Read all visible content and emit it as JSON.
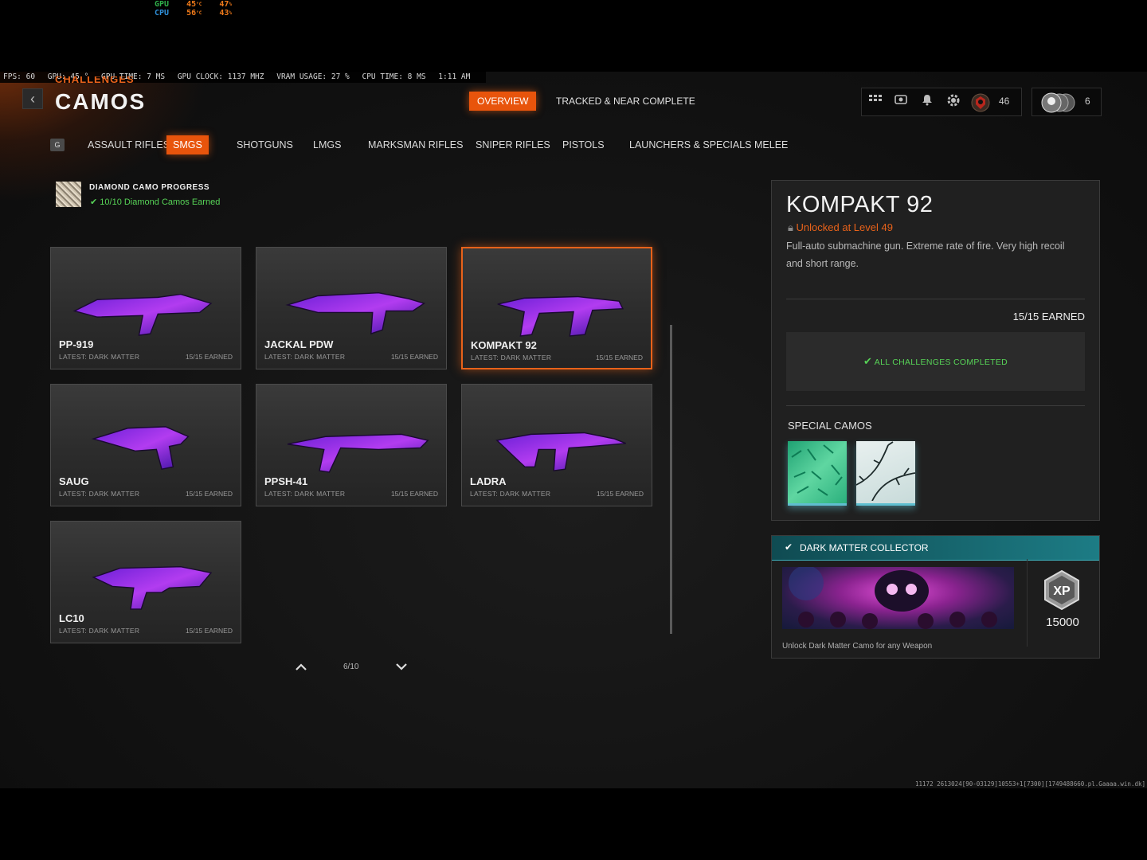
{
  "monitor": {
    "gpu_label": "GPU",
    "cpu_label": "CPU",
    "gpu_temp": "45",
    "gpu_load": "47",
    "cpu_temp": "56",
    "cpu_load": "43",
    "temp_unit": "°C",
    "load_unit": "%"
  },
  "stats_bar": {
    "fps": "FPS:  60",
    "gpu": "GPU: 45 °",
    "gpu_time": "GPU TIME:  7 MS",
    "gpu_clock": "GPU CLOCK: 1137 MHZ",
    "vram": "VRAM USAGE: 27 %",
    "cpu_time": "CPU TIME:  8 MS",
    "clock": "1:11 AM"
  },
  "header": {
    "breadcrumb": "CHALLENGES",
    "title": "CAMOS",
    "tabs": [
      "OVERVIEW",
      "TRACKED & NEAR COMPLETE"
    ],
    "level": "46",
    "prestige": "6"
  },
  "categories": {
    "key_hint": "G",
    "items": [
      "ASSAULT RIFLES",
      "SMGS",
      "SHOTGUNS",
      "LMGS",
      "MARKSMAN RIFLES",
      "SNIPER RIFLES",
      "PISTOLS",
      "LAUNCHERS & SPECIALS",
      "MELEE"
    ],
    "active": "SMGS"
  },
  "diamond": {
    "title": "DIAMOND CAMO PROGRESS",
    "status": "10/10 Diamond Camos Earned"
  },
  "weapons": [
    {
      "name": "PP-919",
      "latest": "LATEST: DARK MATTER",
      "earned": "15/15 EARNED"
    },
    {
      "name": "JACKAL PDW",
      "latest": "LATEST: DARK MATTER",
      "earned": "15/15 EARNED"
    },
    {
      "name": "KOMPAKT 92",
      "latest": "LATEST: DARK MATTER",
      "earned": "15/15 EARNED"
    },
    {
      "name": "SAUG",
      "latest": "LATEST: DARK MATTER",
      "earned": "15/15 EARNED"
    },
    {
      "name": "PPSH-41",
      "latest": "LATEST: DARK MATTER",
      "earned": "15/15 EARNED"
    },
    {
      "name": "LADRA",
      "latest": "LATEST: DARK MATTER",
      "earned": "15/15 EARNED"
    },
    {
      "name": "LC10",
      "latest": "LATEST: DARK MATTER",
      "earned": "15/15 EARNED"
    }
  ],
  "pager": {
    "label": "6/10"
  },
  "detail": {
    "name": "KOMPAKT 92",
    "unlock": "Unlocked at Level 49",
    "description": "Full-auto submachine gun.  Extreme rate of fire. Very high recoil and short range.",
    "earned": "15/15 EARNED",
    "challenges_status": "ALL CHALLENGES COMPLETED",
    "special_title": "SPECIAL CAMOS"
  },
  "reward": {
    "title": "DARK MATTER COLLECTOR",
    "xp": "15000",
    "description": "Unlock Dark Matter Camo for any Weapon"
  },
  "build_string": "11172 2613024[90-03129]10553+1[7300][1749488660.pl.Gaaaa.win.dk]",
  "colors": {
    "accent": "#e8540c",
    "success": "#57d357",
    "teal": "#1f6f78"
  }
}
